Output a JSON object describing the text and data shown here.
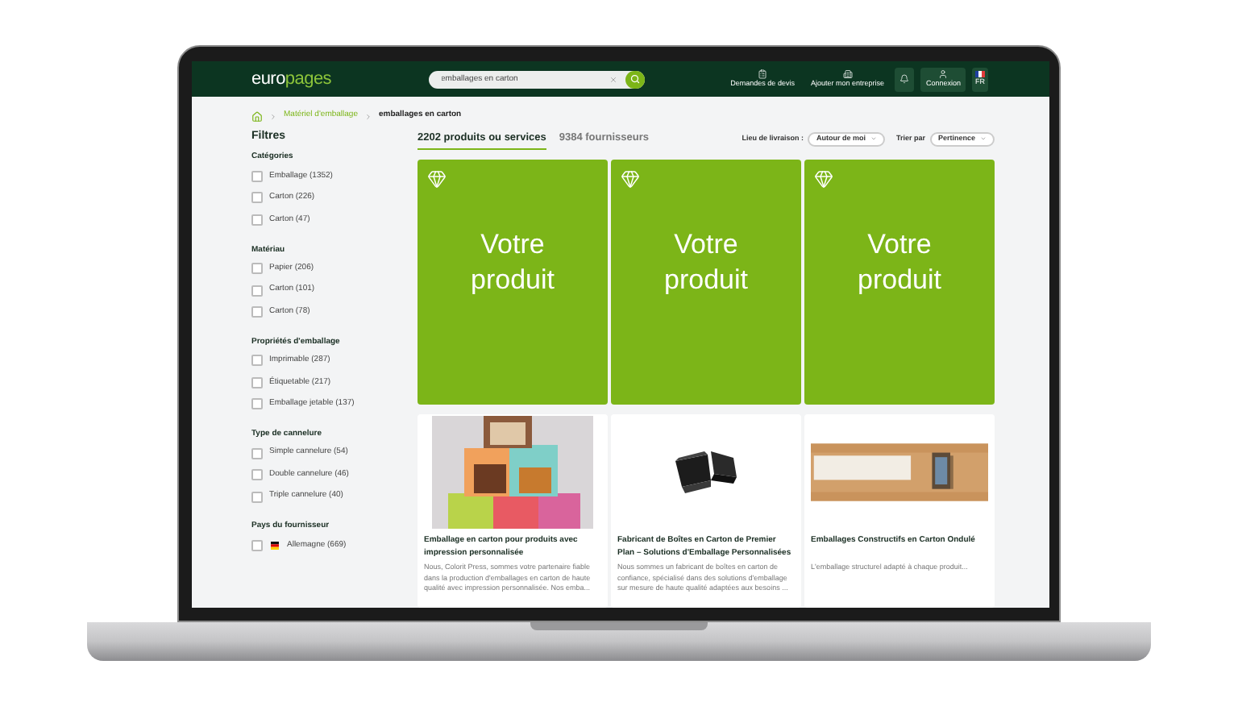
{
  "header": {
    "logo": {
      "part_1": "euro",
      "part_2": "pages"
    },
    "search": {
      "value": "emballages en carton"
    },
    "actions": [
      {
        "kind": "quote",
        "label": "Demandes de devis"
      },
      {
        "kind": "company",
        "label": "Ajouter mon entreprise"
      },
      {
        "kind": "bell"
      },
      {
        "kind": "login",
        "label": "Connexion"
      },
      {
        "kind": "lang",
        "label": "FR"
      }
    ]
  },
  "breadcrumb": [
    {
      "label": "Matériel d'emballage",
      "current": false
    },
    {
      "label": "emballages en carton",
      "current": true
    }
  ],
  "filters": {
    "title": "Filtres",
    "groups": [
      {
        "title": "Catégories",
        "items": [
          {
            "label": "Emballage (1352)",
            "checked": false
          },
          {
            "label": "Carton (226)",
            "checked": false
          },
          {
            "label": "Carton (47)",
            "checked": false
          }
        ]
      },
      {
        "title": "Matériau",
        "items": [
          {
            "label": "Papier (206)",
            "checked": false
          },
          {
            "label": "Carton (101)",
            "checked": false
          },
          {
            "label": "Carton (78)",
            "checked": false
          }
        ]
      },
      {
        "title": "Propriétés d'emballage",
        "items": [
          {
            "label": "Imprimable (287)",
            "checked": false
          },
          {
            "label": "Étiquetable (217)",
            "checked": false
          },
          {
            "label": "Emballage jetable (137)",
            "checked": false
          }
        ]
      },
      {
        "title": "Type de cannelure",
        "items": [
          {
            "label": "Simple cannelure (54)",
            "checked": false
          },
          {
            "label": "Double cannelure (46)",
            "checked": false
          },
          {
            "label": "Triple cannelure (40)",
            "checked": false
          }
        ]
      },
      {
        "title": "Pays du fournisseur",
        "items": [
          {
            "label": "Allemagne (669)",
            "checked": false,
            "kind": "country"
          }
        ]
      }
    ]
  },
  "tabs": [
    {
      "label": "2202 produits ou services",
      "selected": true
    },
    {
      "label": "9384 fournisseurs",
      "selected": false
    }
  ],
  "controls": [
    {
      "label": "Lieu de livraison :",
      "value": "Autour de moi"
    },
    {
      "label": "Trier par",
      "value": "Pertinence"
    }
  ],
  "promo_cards": [
    {
      "text": "Votre produit"
    },
    {
      "text": "Votre produit"
    },
    {
      "text": "Votre produit"
    }
  ],
  "product_cards": [
    {
      "kind": "picture",
      "title": "Emballage en carton pour produits avec impression personnalisée",
      "description": "Nous, Colorit Press, sommes votre partenaire fiable dans la production d'emballages en carton de haute qualité avec impression personnalisée. Nos emba..."
    },
    {
      "kind": "picture",
      "title": "Fabricant de Boîtes en Carton de Premier Plan – Solutions d'Emballage Personnalisées",
      "description": "Nous sommes un fabricant de boîtes en carton de confiance, spécialisé dans des solutions d'emballage sur mesure de haute qualité adaptées aux besoins ..."
    },
    {
      "kind": "picture",
      "title": "Emballages Constructifs en Carton Ondulé",
      "description": "L'emballage structurel adapté à chaque produit..."
    }
  ]
}
